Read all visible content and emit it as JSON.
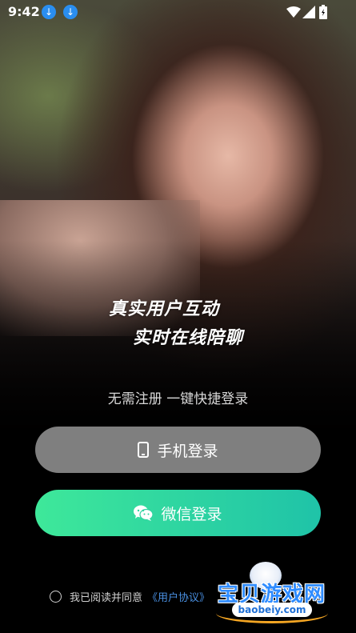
{
  "status_bar": {
    "time": "9:42"
  },
  "slogan": {
    "line1": "真实用户互动",
    "line2": "实时在线陪聊"
  },
  "subtitle": "无需注册 一键快捷登录",
  "buttons": {
    "phone_login": "手机登录",
    "wechat_login": "微信登录"
  },
  "agreement": {
    "prefix": "我已阅读并同意",
    "link_user": "《用户协议》"
  },
  "watermark": {
    "title": "宝贝游戏网",
    "url": "baobeiy.com"
  },
  "colors": {
    "phone_button": "#7f7f7f",
    "wechat_gradient_start": "#3ee89a",
    "wechat_gradient_end": "#1fc3a8",
    "link": "#4a90e2",
    "download_badge": "#2a8ef0"
  }
}
